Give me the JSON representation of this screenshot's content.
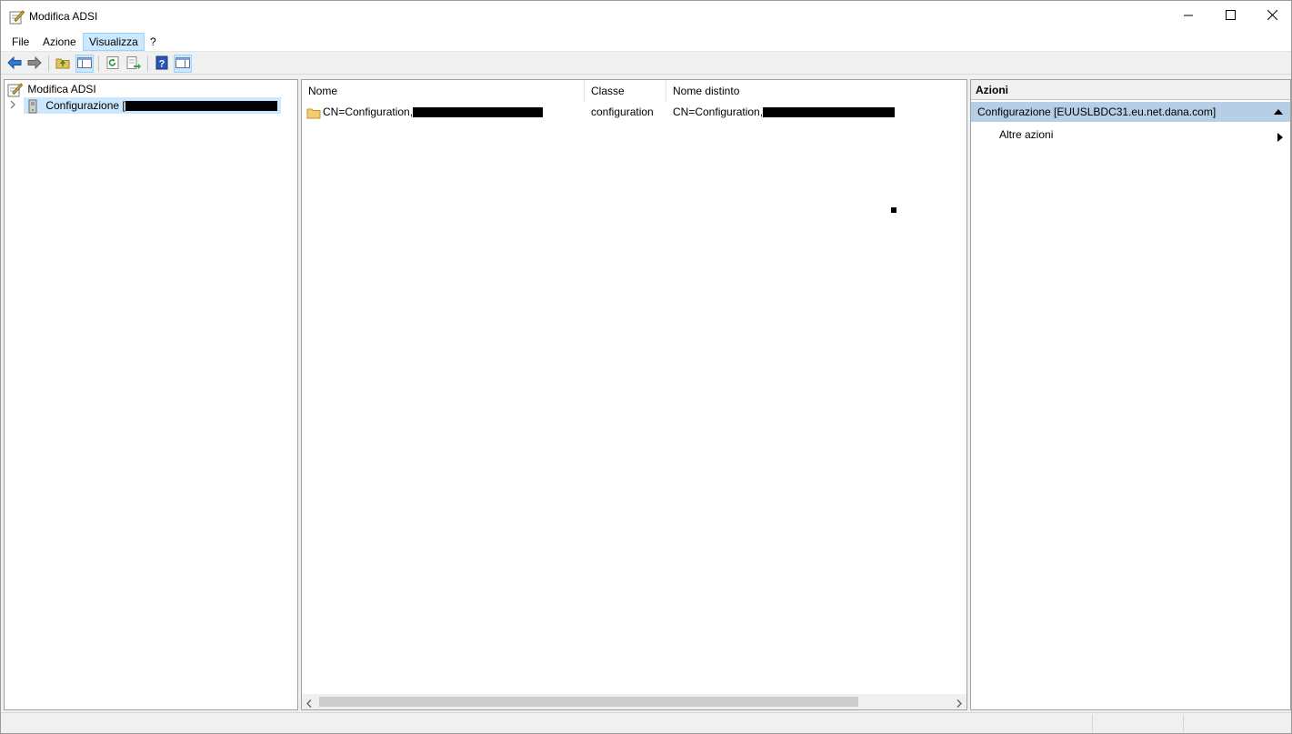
{
  "window": {
    "title": "Modifica ADSI",
    "title_icon": "adsi-edit-icon",
    "controls": [
      "minimize-icon",
      "maximize-icon",
      "close-icon"
    ]
  },
  "menu": {
    "items": [
      {
        "label": "File"
      },
      {
        "label": "Azione"
      },
      {
        "label": "Visualizza",
        "active": true
      },
      {
        "label": "?"
      }
    ]
  },
  "toolbar": {
    "buttons": [
      "back-arrow-icon",
      "forward-arrow-icon",
      "up-folder-icon",
      "show-hide-tree-icon",
      "refresh-icon",
      "export-list-icon",
      "help-icon",
      "show-hide-action-pane-icon"
    ]
  },
  "tree": {
    "root_label": "Modifica ADSI",
    "child_label": "Configurazione [",
    "child_label_tail": "EUUSLBDC31.eu.net.dana.com]"
  },
  "list": {
    "columns": [
      "Nome",
      "Classe",
      "Nome distinto"
    ],
    "rows": [
      {
        "nome": "CN=Configuration,DC=...",
        "nome_visible": "CN=Configuration,",
        "classe": "configuration",
        "nome_distinto": "CN=Configuration,",
        "icon": "folder-icon"
      }
    ]
  },
  "actions": {
    "header": "Azioni",
    "section_label": "Configurazione [EUUSLBDC31.eu.net.dana.com]",
    "item_label": "Altre azioni"
  },
  "colors": {
    "selection": "#cce8ff",
    "action_section": "#b7cfe6"
  }
}
